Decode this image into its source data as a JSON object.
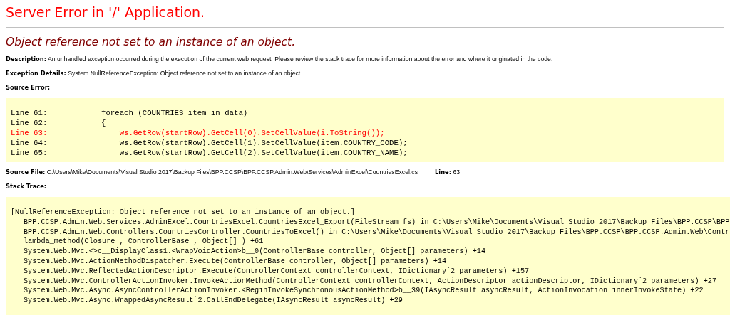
{
  "title": "Server Error in '/' Application.",
  "error_message": "Object reference not set to an instance of an object.",
  "description": {
    "label": "Description:",
    "text": "An unhandled exception occurred during the execution of the current web request. Please review the stack trace for more information about the error and where it originated in the code."
  },
  "exception_details": {
    "label": "Exception Details:",
    "text": "System.NullReferenceException: Object reference not set to an instance of an object."
  },
  "source_error": {
    "label": "Source Error:",
    "lines": [
      {
        "number": "Line 61:",
        "code": "foreach (COUNTRIES item in data)",
        "highlighted": false
      },
      {
        "number": "Line 62:",
        "code": "{",
        "highlighted": false
      },
      {
        "number": "Line 63:",
        "code": "    ws.GetRow(startRow).GetCell(0).SetCellValue(i.ToString());",
        "highlighted": true
      },
      {
        "number": "Line 64:",
        "code": "    ws.GetRow(startRow).GetCell(1).SetCellValue(item.COUNTRY_CODE);",
        "highlighted": false
      },
      {
        "number": "Line 65:",
        "code": "    ws.GetRow(startRow).GetCell(2).SetCellValue(item.COUNTRY_NAME);",
        "highlighted": false
      }
    ]
  },
  "source_file": {
    "label": "Source File:",
    "path": "C:\\Users\\Mike\\Documents\\Visual Studio 2017\\Backup Files\\BPP.CCSP\\BPP.CCSP.Admin.Web\\Services\\AdminExcel\\CountriesExcel.cs",
    "line_label": "Line:",
    "line": "63"
  },
  "stack_trace": {
    "label": "Stack Trace:",
    "lines": [
      {
        "kind": "exception",
        "text": "[NullReferenceException: Object reference not set to an instance of an object.]"
      },
      {
        "kind": "frame",
        "text": "BPP.CCSP.Admin.Web.Services.AdminExcel.CountriesExcel.CountriesExcel_Export(FileStream fs) in C:\\Users\\Mike\\Documents\\Visual Studio 2017\\Backup Files\\BPP.CCSP\\BPP"
      },
      {
        "kind": "frame",
        "text": "BPP.CCSP.Admin.Web.Controllers.CountriesController.CountriesToExcel() in C:\\Users\\Mike\\Documents\\Visual Studio 2017\\Backup Files\\BPP.CCSP\\BPP.CCSP.Admin.Web\\Contr"
      },
      {
        "kind": "frame",
        "text": "lambda_method(Closure , ControllerBase , Object[] ) +61"
      },
      {
        "kind": "frame",
        "text": "System.Web.Mvc.<>c__DisplayClass1.<WrapVoidAction>b__0(ControllerBase controller, Object[] parameters) +14"
      },
      {
        "kind": "frame",
        "text": "System.Web.Mvc.ActionMethodDispatcher.Execute(ControllerBase controller, Object[] parameters) +14"
      },
      {
        "kind": "frame",
        "text": "System.Web.Mvc.ReflectedActionDescriptor.Execute(ControllerContext controllerContext, IDictionary`2 parameters) +157"
      },
      {
        "kind": "frame",
        "text": "System.Web.Mvc.ControllerActionInvoker.InvokeActionMethod(ControllerContext controllerContext, ActionDescriptor actionDescriptor, IDictionary`2 parameters) +27"
      },
      {
        "kind": "frame",
        "text": "System.Web.Mvc.Async.AsyncControllerActionInvoker.<BeginInvokeSynchronousActionMethod>b__39(IAsyncResult asyncResult, ActionInvocation innerInvokeState) +22"
      },
      {
        "kind": "frame",
        "text": "System.Web.Mvc.Async.WrappedAsyncResult`2.CallEndDelegate(IAsyncResult asyncResult) +29"
      }
    ]
  }
}
